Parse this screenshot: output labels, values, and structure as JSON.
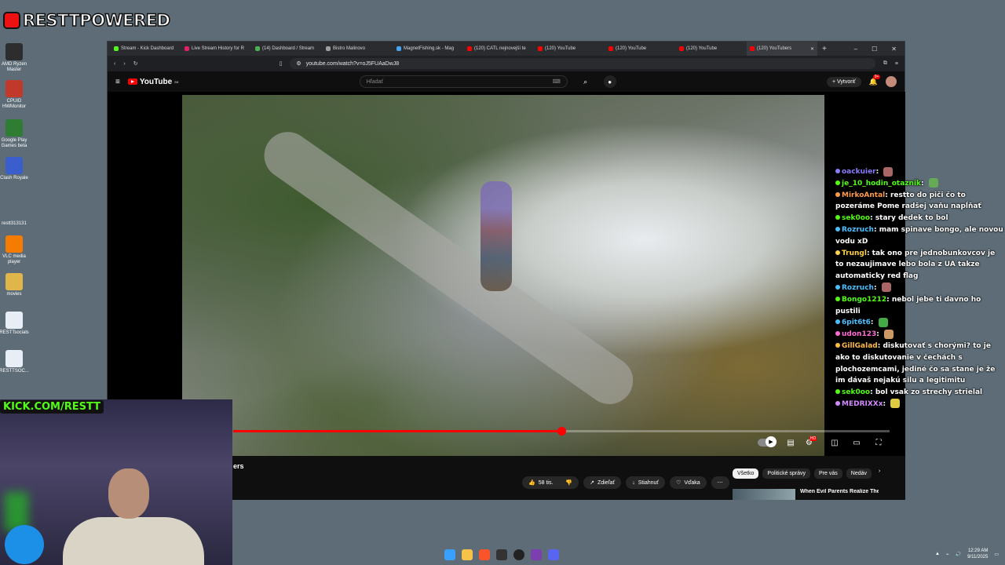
{
  "overlay": {
    "brand_text": "RESTTPOWERED",
    "kick_prefix": "KICK.COM/",
    "kick_name": "RESTT"
  },
  "desktop_icons": [
    {
      "label": "AMD Ryzen Master",
      "color": "#2d2d2d"
    },
    {
      "label": "CPUID HWMonitor",
      "color": "#c0392b"
    },
    {
      "label": "Google Play Games beta",
      "color": "#2e7d32"
    },
    {
      "label": "Clash Royale",
      "color": "#3a5fcd"
    },
    {
      "label": "restt313131",
      "color": "#5d6c76"
    },
    {
      "label": "VLC media player",
      "color": "#f57c00"
    },
    {
      "label": "movies",
      "color": "#e0b64a"
    },
    {
      "label": "RESTTsocials",
      "color": "#e8eef5"
    },
    {
      "label": "RESTTSOC...",
      "color": "#e8eef5"
    }
  ],
  "browser": {
    "tabs": [
      {
        "label": "Stream - Kick Dashboard",
        "color": "#53fc18"
      },
      {
        "label": "Live Stream History for R",
        "color": "#e91e63"
      },
      {
        "label": "(14) Dashboard / Stream",
        "color": "#4caf50"
      },
      {
        "label": "Bistro Malinovo",
        "color": "#9e9e9e"
      },
      {
        "label": "MagnetFishing.sk - Mag",
        "color": "#42a5f5"
      },
      {
        "label": "(120) CATL nejnovejší te",
        "color": "#f00"
      },
      {
        "label": "(120) YouTube",
        "color": "#f00"
      },
      {
        "label": "(120) YouTube",
        "color": "#f00"
      },
      {
        "label": "(120) YouTube",
        "color": "#f00"
      },
      {
        "label": "(120) YouTubers",
        "color": "#f00"
      }
    ],
    "url": "youtube.com/watch?v=oJ5FUAaDwJ8",
    "window_controls": [
      "–",
      "☐",
      "✕"
    ]
  },
  "youtube": {
    "logo_text": "YouTube",
    "country": "SK",
    "search_placeholder": "Hľadať",
    "create_label": "Vytvoriť",
    "notifications": "9+",
    "progress": 0.5,
    "below_title": "ers",
    "actions": {
      "likes": "58 tis.",
      "share": "Zdieľať",
      "download": "Stiahnuť",
      "thanks": "Vďaka"
    },
    "chips": [
      "Všetko",
      "Politické správy",
      "Pre vás",
      "Nedáv"
    ],
    "rec_title": "When Evil Parents Realize They've Been Caught"
  },
  "chat": [
    {
      "user": "oackuier",
      "text": "",
      "color": "#8a7cff",
      "emote": "#a66"
    },
    {
      "user": "je_10_hodin_otaznik",
      "text": "",
      "color": "#53fc18",
      "emote": "#6a5"
    },
    {
      "user": "MirkoAntal",
      "text": "restto do piči čo to pozeráme Pome radšej vaňu napĺňať",
      "color": "#ff9b4a",
      "emote": ""
    },
    {
      "user": "sek0oo",
      "text": "stary dedek to bol",
      "color": "#53fc18",
      "emote": ""
    },
    {
      "user": "Rozruch",
      "text": "mam spinave bongo, ale novou vodu xD",
      "color": "#4ac0ff",
      "emote": ""
    },
    {
      "user": "Trungl",
      "text": "tak ono pre jednobunkovcov je to nezaujimave lebo bola z UA takze automaticky red flag",
      "color": "#ffd24a",
      "emote": ""
    },
    {
      "user": "Rozruch",
      "text": "",
      "color": "#4ac0ff",
      "emote": "#a66"
    },
    {
      "user": "Bongo1212",
      "text": "nebol jebe ti davno ho pustili",
      "color": "#53fc18",
      "emote": ""
    },
    {
      "user": "6pit6t6",
      "text": "",
      "color": "#4ac0ff",
      "emote": "#4a4"
    },
    {
      "user": "udon123",
      "text": "",
      "color": "#ff6ad5",
      "emote": "#c96"
    },
    {
      "user": "GillGalad",
      "text": "diskutovať s chorými? to je ako to diskutovanie v čechách s plochozemcami, jediné čo sa stane je že im dávaš nejakú silu a legitimitu",
      "color": "#ffb84a",
      "emote": ""
    },
    {
      "user": "sek0oo",
      "text": "bol vsak zo strechy strielal",
      "color": "#53fc18",
      "emote": ""
    },
    {
      "user": "MEDRIXXx",
      "text": "",
      "color": "#d28aff",
      "emote": "#dc4"
    }
  ],
  "taskbar": {
    "time": "12:29 AM",
    "date": "9/11/2025"
  }
}
